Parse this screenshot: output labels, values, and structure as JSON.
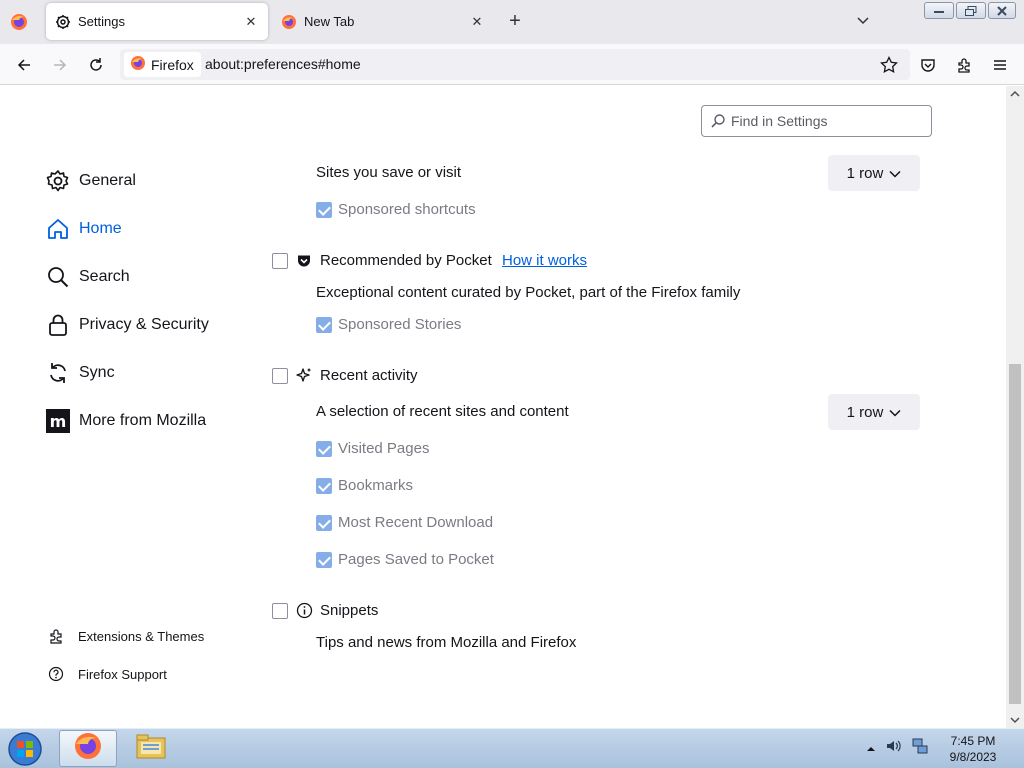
{
  "browser": {
    "tabs": [
      {
        "label": "Settings",
        "icon": "gear-icon",
        "active": true
      },
      {
        "label": "New Tab",
        "icon": "firefox-icon",
        "active": false
      }
    ],
    "identity_label": "Firefox",
    "url": "about:preferences#home"
  },
  "search": {
    "placeholder": "Find in Settings"
  },
  "sidebar": {
    "items": [
      {
        "label": "General",
        "icon": "gear-icon"
      },
      {
        "label": "Home",
        "icon": "home-icon",
        "selected": true
      },
      {
        "label": "Search",
        "icon": "search-icon"
      },
      {
        "label": "Privacy & Security",
        "icon": "lock-icon"
      },
      {
        "label": "Sync",
        "icon": "sync-icon"
      },
      {
        "label": "More from Mozilla",
        "icon": "mozilla-icon"
      }
    ],
    "footer": [
      {
        "label": "Extensions & Themes",
        "icon": "puzzle-icon"
      },
      {
        "label": "Firefox Support",
        "icon": "help-icon"
      }
    ]
  },
  "home": {
    "shortcuts": {
      "description": "Sites you save or visit",
      "rows": "1 row",
      "sponsored_shortcuts": {
        "label": "Sponsored shortcuts",
        "checked": true
      }
    },
    "pocket": {
      "title": "Recommended by Pocket",
      "checked": false,
      "link": "How it works",
      "description": "Exceptional content curated by Pocket, part of the Firefox family",
      "sponsored_stories": {
        "label": "Sponsored Stories",
        "checked": true
      }
    },
    "recent_activity": {
      "title": "Recent activity",
      "checked": false,
      "description": "A selection of recent sites and content",
      "rows": "1 row",
      "options": [
        {
          "label": "Visited Pages",
          "checked": true
        },
        {
          "label": "Bookmarks",
          "checked": true
        },
        {
          "label": "Most Recent Download",
          "checked": true
        },
        {
          "label": "Pages Saved to Pocket",
          "checked": true
        }
      ]
    },
    "snippets": {
      "title": "Snippets",
      "checked": false,
      "description": "Tips and news from Mozilla and Firefox"
    }
  },
  "taskbar": {
    "time": "7:45 PM",
    "date": "9/8/2023"
  },
  "colors": {
    "accent": "#0061e0",
    "disabled_check": "#85aee9"
  }
}
